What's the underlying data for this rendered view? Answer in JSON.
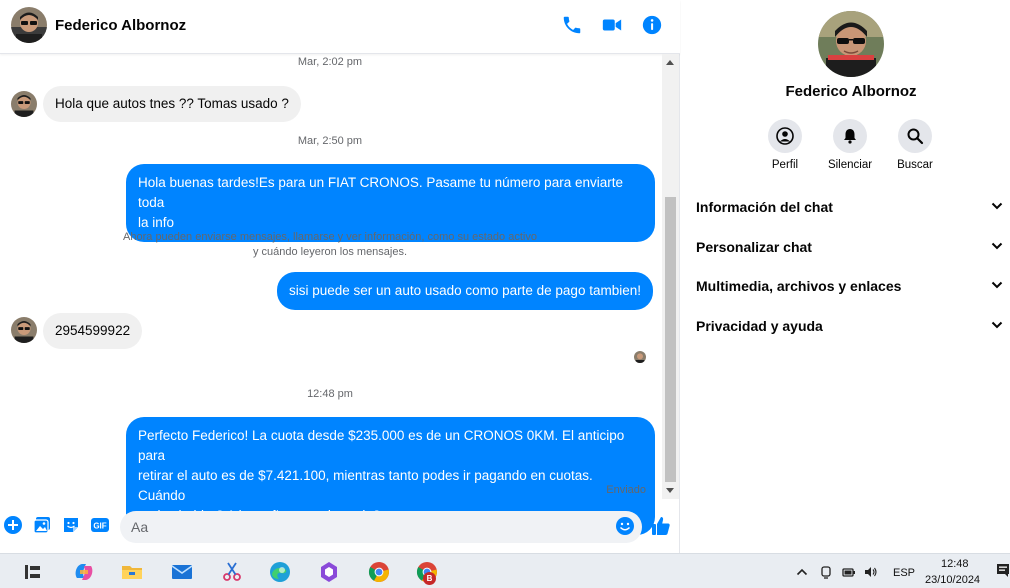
{
  "contact": {
    "name": "Federico Albornoz"
  },
  "header": {
    "icons": [
      "phone-icon",
      "video-icon",
      "info-icon"
    ]
  },
  "messages": {
    "ts1": "Mar, 2:02 pm",
    "in1": "Hola que autos tnes ?? Tomas usado ?",
    "ts2": "Mar, 2:50 pm",
    "out1_line1": "Hola buenas tardes!Es para un FIAT CRONOS. Pasame tu número para enviarte toda",
    "out1_line2": "la info",
    "notice_line1": "Ahora pueden enviarse mensajes, llamarse y ver información, como su estado activo",
    "notice_line2": "y cuándo leyeron los mensajes.",
    "out2": "sisi puede ser un auto  usado como parte de pago tambien!",
    "in2": "2954599922",
    "ts3": "12:48 pm",
    "out3_line1": "Perfecto Federico! La cuota desde $235.000 es de un CRONOS 0KM. El anticipo para",
    "out3_line2": "retirar el auto es de $7.421.100, mientras tanto podes ir pagando en cuotas. Cuándo",
    "out3_line3": "podes hablar? A la mañana o a la tarde?",
    "status": "Enviado"
  },
  "composer": {
    "placeholder": "Aa",
    "icons": [
      "plus-icon",
      "image-icon",
      "sticker-icon",
      "gif-icon",
      "emoji-icon",
      "thumbs-up-icon"
    ],
    "gif_label": "GIF"
  },
  "panel": {
    "actions": [
      {
        "label": "Perfil",
        "icon": "profile-icon"
      },
      {
        "label": "Silenciar",
        "icon": "bell-icon"
      },
      {
        "label": "Buscar",
        "icon": "search-icon"
      }
    ],
    "sections": [
      "Información del chat",
      "Personalizar chat",
      "Multimedia, archivos y enlaces",
      "Privacidad y ayuda"
    ]
  },
  "taskbar": {
    "apps": [
      "task-view-icon",
      "copilot-icon",
      "file-explorer-icon",
      "mail-icon",
      "snipping-icon",
      "edge-icon",
      "office-icon",
      "chrome-icon",
      "chrome-profile-icon"
    ],
    "profile_badge": "B",
    "language": "ESP",
    "time": "12:48",
    "date": "23/10/2024"
  },
  "colors": {
    "accent": "#0084ff",
    "incoming_bubble": "#f0f0f0",
    "text_secondary": "#65676b"
  }
}
